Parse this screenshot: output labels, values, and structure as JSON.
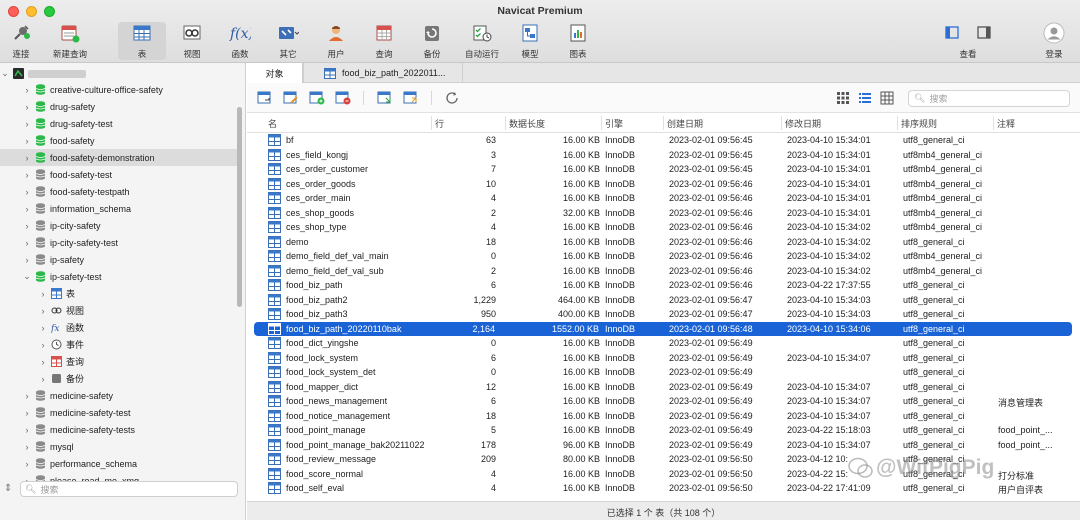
{
  "app": {
    "title": "Navicat Premium"
  },
  "toolbar": [
    {
      "label": "连接",
      "icon": "connect-icon"
    },
    {
      "label": "新建查询",
      "icon": "new-query-icon"
    },
    {
      "label": "表",
      "icon": "table-icon"
    },
    {
      "label": "视图",
      "icon": "view-icon"
    },
    {
      "label": "函数",
      "icon": "function-icon"
    },
    {
      "label": "其它",
      "icon": "other-icon"
    },
    {
      "label": "用户",
      "icon": "user-icon"
    },
    {
      "label": "查询",
      "icon": "query-icon"
    },
    {
      "label": "备份",
      "icon": "backup-icon"
    },
    {
      "label": "自动运行",
      "icon": "automation-icon"
    },
    {
      "label": "模型",
      "icon": "model-icon"
    },
    {
      "label": "图表",
      "icon": "chart-icon"
    },
    {
      "label": "查看",
      "icon": "view-layout-icon"
    },
    {
      "label": "登录",
      "icon": "login-icon"
    }
  ],
  "sidebar": {
    "connection": "",
    "items": [
      {
        "label": "creative-culture-office-safety",
        "green": true
      },
      {
        "label": "drug-safety",
        "green": true
      },
      {
        "label": "drug-safety-test",
        "green": true
      },
      {
        "label": "food-safety",
        "green": true
      },
      {
        "label": "food-safety-demonstration",
        "green": true
      },
      {
        "label": "food-safety-test",
        "green": false
      },
      {
        "label": "food-safety-testpath",
        "green": false
      },
      {
        "label": "information_schema",
        "green": false
      },
      {
        "label": "ip-city-safety",
        "green": false
      },
      {
        "label": "ip-city-safety-test",
        "green": false
      },
      {
        "label": "ip-safety",
        "green": false
      },
      {
        "label": "ip-safety-test",
        "green": true
      },
      {
        "label": "表",
        "sub": true
      },
      {
        "label": "视图",
        "sub": true
      },
      {
        "label": "函数",
        "sub": true
      },
      {
        "label": "事件",
        "sub": true
      },
      {
        "label": "查询",
        "sub": true
      },
      {
        "label": "备份",
        "sub": true
      },
      {
        "label": "medicine-safety",
        "green": false
      },
      {
        "label": "medicine-safety-test",
        "green": false
      },
      {
        "label": "medicine-safety-tests",
        "green": false
      },
      {
        "label": "mysql",
        "green": false
      },
      {
        "label": "performance_schema",
        "green": false
      },
      {
        "label": "please_read_me_xmg",
        "green": false
      }
    ],
    "search_placeholder": "搜索"
  },
  "tabs": [
    "对象",
    "food_biz_path_2022011..."
  ],
  "search_placeholder": "搜索",
  "columns": [
    "名",
    "行",
    "数据长度",
    "引擎",
    "创建日期",
    "修改日期",
    "排序规则",
    "注释"
  ],
  "rows": [
    [
      "bf",
      "63",
      "16.00 KB",
      "InnoDB",
      "2023-02-01 09:56:45",
      "2023-04-10 15:34:01",
      "utf8_general_ci",
      ""
    ],
    [
      "ces_field_kongj",
      "3",
      "16.00 KB",
      "InnoDB",
      "2023-02-01 09:56:45",
      "2023-04-10 15:34:01",
      "utf8mb4_general_ci",
      ""
    ],
    [
      "ces_order_customer",
      "7",
      "16.00 KB",
      "InnoDB",
      "2023-02-01 09:56:45",
      "2023-04-10 15:34:01",
      "utf8mb4_general_ci",
      ""
    ],
    [
      "ces_order_goods",
      "10",
      "16.00 KB",
      "InnoDB",
      "2023-02-01 09:56:46",
      "2023-04-10 15:34:01",
      "utf8mb4_general_ci",
      ""
    ],
    [
      "ces_order_main",
      "4",
      "16.00 KB",
      "InnoDB",
      "2023-02-01 09:56:46",
      "2023-04-10 15:34:01",
      "utf8mb4_general_ci",
      ""
    ],
    [
      "ces_shop_goods",
      "2",
      "32.00 KB",
      "InnoDB",
      "2023-02-01 09:56:46",
      "2023-04-10 15:34:01",
      "utf8mb4_general_ci",
      ""
    ],
    [
      "ces_shop_type",
      "4",
      "16.00 KB",
      "InnoDB",
      "2023-02-01 09:56:46",
      "2023-04-10 15:34:02",
      "utf8mb4_general_ci",
      ""
    ],
    [
      "demo",
      "18",
      "16.00 KB",
      "InnoDB",
      "2023-02-01 09:56:46",
      "2023-04-10 15:34:02",
      "utf8_general_ci",
      ""
    ],
    [
      "demo_field_def_val_main",
      "0",
      "16.00 KB",
      "InnoDB",
      "2023-02-01 09:56:46",
      "2023-04-10 15:34:02",
      "utf8mb4_general_ci",
      ""
    ],
    [
      "demo_field_def_val_sub",
      "2",
      "16.00 KB",
      "InnoDB",
      "2023-02-01 09:56:46",
      "2023-04-10 15:34:02",
      "utf8mb4_general_ci",
      ""
    ],
    [
      "food_biz_path",
      "6",
      "16.00 KB",
      "InnoDB",
      "2023-02-01 09:56:46",
      "2023-04-22 17:37:55",
      "utf8_general_ci",
      ""
    ],
    [
      "food_biz_path2",
      "1,229",
      "464.00 KB",
      "InnoDB",
      "2023-02-01 09:56:47",
      "2023-04-10 15:34:03",
      "utf8_general_ci",
      ""
    ],
    [
      "food_biz_path3",
      "950",
      "400.00 KB",
      "InnoDB",
      "2023-02-01 09:56:47",
      "2023-04-10 15:34:03",
      "utf8_general_ci",
      ""
    ],
    [
      "food_biz_path_20220110bak",
      "2,164",
      "1552.00 KB",
      "InnoDB",
      "2023-02-01 09:56:48",
      "2023-04-10 15:34:06",
      "utf8_general_ci",
      ""
    ],
    [
      "food_dict_yingshe",
      "0",
      "16.00 KB",
      "InnoDB",
      "2023-02-01 09:56:49",
      "",
      "utf8_general_ci",
      ""
    ],
    [
      "food_lock_system",
      "6",
      "16.00 KB",
      "InnoDB",
      "2023-02-01 09:56:49",
      "2023-04-10 15:34:07",
      "utf8_general_ci",
      ""
    ],
    [
      "food_lock_system_det",
      "0",
      "16.00 KB",
      "InnoDB",
      "2023-02-01 09:56:49",
      "",
      "utf8_general_ci",
      ""
    ],
    [
      "food_mapper_dict",
      "12",
      "16.00 KB",
      "InnoDB",
      "2023-02-01 09:56:49",
      "2023-04-10 15:34:07",
      "utf8_general_ci",
      ""
    ],
    [
      "food_news_management",
      "6",
      "16.00 KB",
      "InnoDB",
      "2023-02-01 09:56:49",
      "2023-04-10 15:34:07",
      "utf8_general_ci",
      "消息管理表"
    ],
    [
      "food_notice_management",
      "18",
      "16.00 KB",
      "InnoDB",
      "2023-02-01 09:56:49",
      "2023-04-10 15:34:07",
      "utf8_general_ci",
      ""
    ],
    [
      "food_point_manage",
      "5",
      "16.00 KB",
      "InnoDB",
      "2023-02-01 09:56:49",
      "2023-04-22 15:18:03",
      "utf8_general_ci",
      "food_point_..."
    ],
    [
      "food_point_manage_bak20211022",
      "178",
      "96.00 KB",
      "InnoDB",
      "2023-02-01 09:56:49",
      "2023-04-10 15:34:07",
      "utf8_general_ci",
      "food_point_..."
    ],
    [
      "food_review_message",
      "209",
      "80.00 KB",
      "InnoDB",
      "2023-02-01 09:56:50",
      "2023-04-12 10:",
      "utf8_general_ci",
      ""
    ],
    [
      "food_score_normal",
      "4",
      "16.00 KB",
      "InnoDB",
      "2023-02-01 09:56:50",
      "2023-04-22 15:",
      "utf8_general_ci",
      "打分标准"
    ],
    [
      "food_self_eval",
      "4",
      "16.00 KB",
      "InnoDB",
      "2023-02-01 09:56:50",
      "2023-04-22 17:41:09",
      "utf8_general_ci",
      "用户自评表"
    ]
  ],
  "selected_row": 13,
  "status": "已选择 1 个 表（共 108 个）",
  "watermark": "@WitPigPig"
}
